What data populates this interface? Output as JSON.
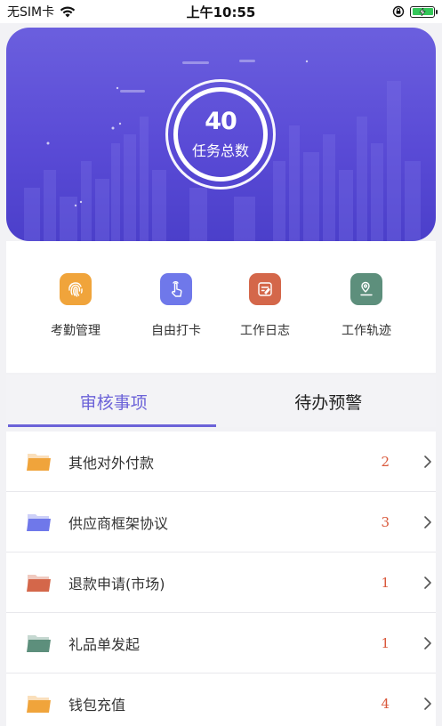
{
  "status_bar": {
    "carrier": "无SIM卡",
    "time": "上午10:55"
  },
  "banner": {
    "total_value": "40",
    "total_label": "任务总数"
  },
  "actions": [
    {
      "label": "考勤管理",
      "icon": "fingerprint-icon",
      "color": "#f0a43b"
    },
    {
      "label": "自由打卡",
      "icon": "tap-hand-icon",
      "color": "#6f78ea"
    },
    {
      "label": "工作日志",
      "icon": "notepad-icon",
      "color": "#d4674a"
    },
    {
      "label": "工作轨迹",
      "icon": "location-track-icon",
      "color": "#5d8f7c"
    }
  ],
  "tabs": [
    {
      "label": "审核事项",
      "active": true
    },
    {
      "label": "待办预警",
      "active": false
    }
  ],
  "list": [
    {
      "title": "其他对外付款",
      "count": "2",
      "color": "#f0a43b"
    },
    {
      "title": "供应商框架协议",
      "count": "3",
      "color": "#6f78ea"
    },
    {
      "title": "退款申请(市场)",
      "count": "1",
      "color": "#d4674a"
    },
    {
      "title": "礼品单发起",
      "count": "1",
      "color": "#5d8f7c"
    },
    {
      "title": "钱包充值",
      "count": "4",
      "color": "#f0a43b"
    }
  ],
  "colors": {
    "accent": "#6b62d8",
    "count": "#d9583b"
  }
}
